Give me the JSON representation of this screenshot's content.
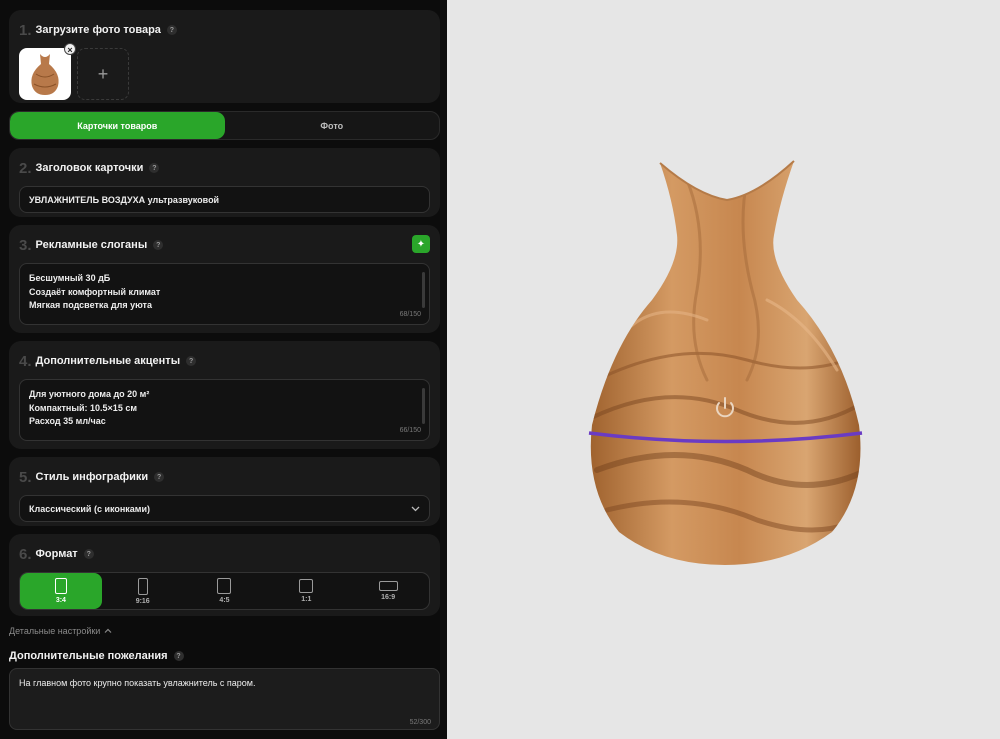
{
  "upload": {
    "num": "1.",
    "title": "Загрузите фото товара",
    "help": "?",
    "close": "×",
    "add": "+"
  },
  "tabs": [
    {
      "label": "Карточки товаров",
      "active": true
    },
    {
      "label": "Фото",
      "active": false
    }
  ],
  "heading": {
    "num": "2.",
    "title": "Заголовок карточки",
    "help": "?",
    "value": "УВЛАЖНИТЕЛЬ ВОЗДУХА ультразвуковой"
  },
  "slogans": {
    "num": "3.",
    "title": "Рекламные слоганы",
    "help": "?",
    "lines": [
      "Бесшумный 30 дБ",
      "Создаёт комфортный климат",
      "Мягкая подсветка для уюта"
    ],
    "counter": "68/150"
  },
  "accents": {
    "num": "4.",
    "title": "Дополнительные акценты",
    "help": "?",
    "lines": [
      "Для уютного дома до 20 м²",
      "Компактный: 10.5×15 см",
      "Расход 35 мл/час"
    ],
    "counter": "66/150"
  },
  "style": {
    "num": "5.",
    "title": "Стиль инфографики",
    "help": "?",
    "value": "Классический (с иконками)"
  },
  "format": {
    "num": "6.",
    "title": "Формат",
    "help": "?",
    "options": [
      {
        "label": "3:4",
        "active": true
      },
      {
        "label": "9:16",
        "active": false
      },
      {
        "label": "4:5",
        "active": false
      },
      {
        "label": "1:1",
        "active": false
      },
      {
        "label": "16:9",
        "active": false
      }
    ]
  },
  "details": {
    "label": "Детальные настройки",
    "chevron": "^"
  },
  "extra": {
    "title": "Дополнительные пожелания",
    "help": "?",
    "value": "На главном фото крупно показать увлажнитель с паром.",
    "counter": "52/300"
  },
  "colors": {
    "accent": "#2aa62a",
    "wood_light": "#c98d58",
    "wood_dark": "#8a5228",
    "ring": "#6a3bc4"
  }
}
